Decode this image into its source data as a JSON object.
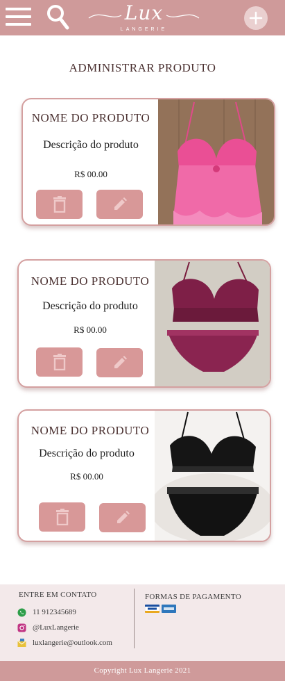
{
  "header": {
    "brand_name": "Lux",
    "brand_subtitle": "LANGERIE"
  },
  "page_title": "ADMINISTRAR PRODUTO",
  "products": [
    {
      "name": "NOME DO PRODUTO",
      "description": "Descrição do produto",
      "price": "R$ 00.00",
      "image": "pink-lace-corset-photo"
    },
    {
      "name": "NOME DO PRODUTO",
      "description": "Descrição do produto",
      "price": "R$ 00.00",
      "image": "burgundy-lace-lingerie-set-photo"
    },
    {
      "name": "NOME DO PRODUTO",
      "description": "Descrição do produto",
      "price": "R$ 00.00",
      "image": "black-lace-lingerie-set-photo"
    }
  ],
  "footer": {
    "contact_title": "ENTRE EM CONTATO",
    "phone": "11 912345689",
    "instagram": "@LuxLangerie",
    "email": "luxlangerie@outlook.com",
    "payment_title": "FORMAS DE PAGAMENTO",
    "payment_methods": [
      "visa-card-icon",
      "amex-card-icon"
    ]
  },
  "copyright": "Copyright Lux Langerie 2021",
  "colors": {
    "brand_pink": "#cf9a9a",
    "button_pink": "#d89898",
    "card_border": "#d4a0a0",
    "footer_bg": "#f3e9ea"
  }
}
